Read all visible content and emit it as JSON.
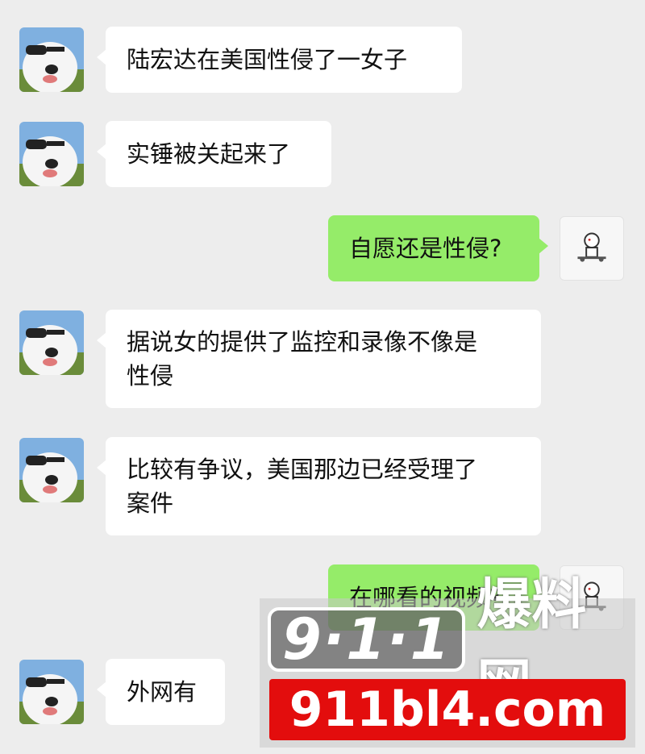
{
  "messages": [
    {
      "side": "in",
      "text": "陆宏达在美国性侵了一女子"
    },
    {
      "side": "in",
      "text": "实锤被关起来了"
    },
    {
      "side": "out",
      "text": "自愿还是性侵?"
    },
    {
      "side": "in",
      "text": "据说女的提供了监控和录像不像是\n性侵"
    },
    {
      "side": "in",
      "text": "比较有争议，美国那边已经受理了\n案件"
    },
    {
      "side": "out",
      "text": "在哪看的视频?"
    },
    {
      "side": "in",
      "text": "外网有"
    }
  ],
  "avatars": {
    "contact": "dog-with-sunglasses-icon",
    "self": "cartoon-character-icon"
  },
  "colors": {
    "background": "#ededed",
    "incoming_bubble": "#ffffff",
    "outgoing_bubble": "#95ec69",
    "watermark_red": "#e30d0d"
  },
  "watermark": {
    "logo_number": "9·1·1",
    "logo_text": "爆料网",
    "url": "911bl4.com"
  }
}
